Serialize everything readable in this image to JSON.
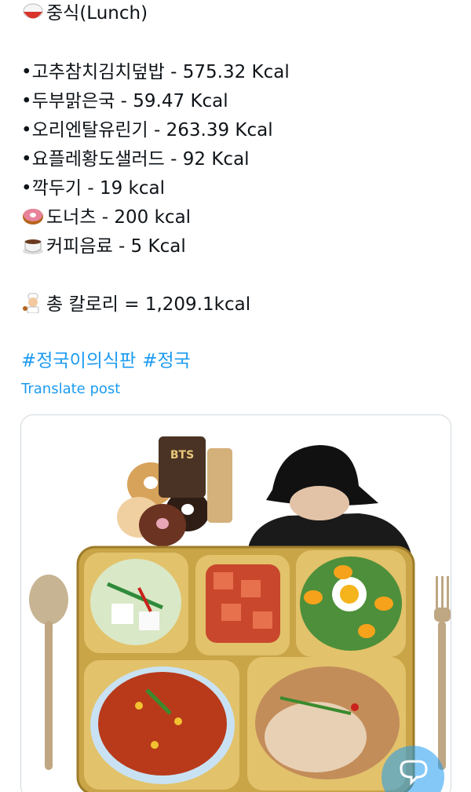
{
  "post": {
    "heading": "중식(Lunch)",
    "menu": [
      "•고추참치김치덮밥 - 575.32 Kcal",
      "•두부맑은국 - 59.47 Kcal",
      "•오리엔탈유린기 - 263.39 Kcal",
      "•요플레황도샐러드 - 92 Kcal",
      "•깍두기 - 19 kcal",
      "도너츠 - 200 kcal",
      "커피음료 - 5 Kcal"
    ],
    "total": "총 칼로리  =  1,209.1kcal",
    "hashtags": [
      "#정국이의식판",
      "#정국"
    ],
    "translate_label": "Translate post"
  },
  "media": {
    "can_label": "BTS",
    "description_icons": [
      "rice-bowl-icon",
      "donut-icon",
      "coffee-icon",
      "cook-icon"
    ]
  },
  "colors": {
    "link": "#1d9bf0",
    "text": "#0f1419",
    "tray": "#c9a548",
    "border": "#cfd9de"
  }
}
